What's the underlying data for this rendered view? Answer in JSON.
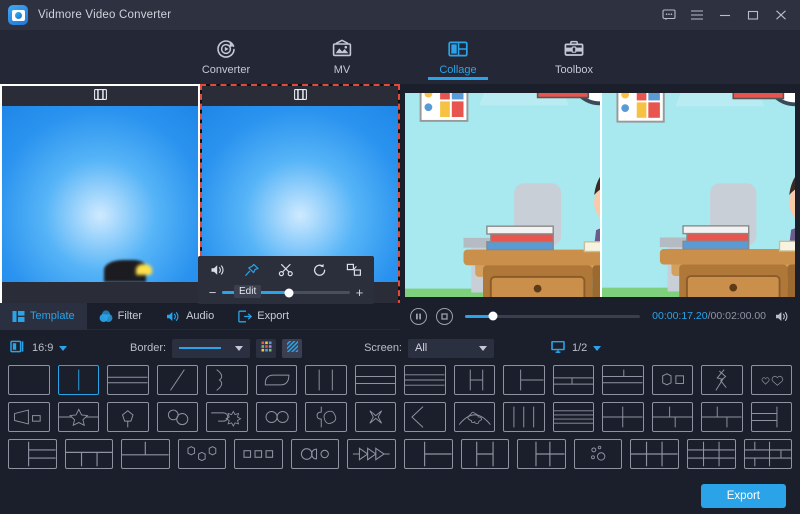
{
  "window": {
    "app_title": "Vidmore Video Converter",
    "controls": [
      {
        "name": "feedback-icon",
        "label": "Feedback"
      },
      {
        "name": "menu-icon",
        "label": "Menu"
      },
      {
        "name": "minimize-icon",
        "label": "Minimize"
      },
      {
        "name": "maximize-icon",
        "label": "Maximize"
      },
      {
        "name": "close-icon",
        "label": "Close"
      }
    ]
  },
  "nav": {
    "tabs": [
      {
        "label": "Converter",
        "icon": "converter-icon",
        "active": false
      },
      {
        "label": "MV",
        "icon": "mv-icon",
        "active": false
      },
      {
        "label": "Collage",
        "icon": "collage-icon",
        "active": true
      },
      {
        "label": "Toolbox",
        "icon": "toolbox-icon",
        "active": false
      }
    ]
  },
  "editor": {
    "cells": [
      {
        "name": "collage-cell-1",
        "icon": "film-strip-icon",
        "selected": false
      },
      {
        "name": "collage-cell-2",
        "icon": "film-strip-icon",
        "selected": true
      }
    ],
    "edit_toolbar": {
      "tooltip": "Edit",
      "tools": [
        {
          "name": "volume-icon",
          "label": "Volume"
        },
        {
          "name": "pin-icon",
          "label": "Pin"
        },
        {
          "name": "trim-scissors-icon",
          "label": "Trim"
        },
        {
          "name": "rotate-icon",
          "label": "Rotate"
        },
        {
          "name": "crop-icon",
          "label": "Crop"
        }
      ],
      "minus": "−",
      "plus": "+",
      "value_percent": 52
    }
  },
  "player": {
    "pause_icon": "pause-icon",
    "stop_icon": "stop-icon",
    "volume_icon": "speaker-icon",
    "current_time": "00:00:17.20",
    "separator": "/",
    "total_time": "00:02:00.00",
    "progress_percent": 16
  },
  "section_tabs": [
    {
      "label": "Template",
      "icon": "template-icon",
      "active": true
    },
    {
      "label": "Filter",
      "icon": "filter-icon",
      "active": false
    },
    {
      "label": "Audio",
      "icon": "audio-icon",
      "active": false
    },
    {
      "label": "Export",
      "icon": "export-icon",
      "active": false
    }
  ],
  "options": {
    "aspect_icon": "aspect-ratio-icon",
    "aspect_value": "16:9",
    "border_label": "Border:",
    "border_style": "solid-line",
    "border_color_icon": "color-palette-icon",
    "border_pattern_icon": "stripe-pattern-icon",
    "screen_label": "Screen:",
    "screen_value": "All",
    "monitor_icon": "monitor-icon",
    "page_value": "1/2"
  },
  "templates": {
    "rows": [
      [
        {
          "name": "tpl-single",
          "active": false
        },
        {
          "name": "tpl-two-vertical",
          "active": true
        },
        {
          "name": "tpl-two-horizontal",
          "active": false
        },
        {
          "name": "tpl-diagonal-split",
          "active": false
        },
        {
          "name": "tpl-curved-split",
          "active": false
        },
        {
          "name": "tpl-rounded-inset",
          "active": false
        },
        {
          "name": "tpl-three-columns",
          "active": false
        },
        {
          "name": "tpl-three-rows",
          "active": false
        },
        {
          "name": "tpl-four-rows",
          "active": false
        },
        {
          "name": "tpl-left-large-two-right",
          "active": false
        },
        {
          "name": "tpl-two-left-two-right",
          "active": false
        },
        {
          "name": "tpl-top-bar-two-bottom",
          "active": false
        },
        {
          "name": "tpl-top-split-bottom-bar",
          "active": false
        },
        {
          "name": "tpl-hexagon-square",
          "active": false
        },
        {
          "name": "tpl-lightning-split",
          "active": false
        },
        {
          "name": "tpl-two-hearts",
          "active": false
        }
      ],
      [
        {
          "name": "tpl-megaphone",
          "active": false
        },
        {
          "name": "tpl-star-band",
          "active": false
        },
        {
          "name": "tpl-pentagon",
          "active": false
        },
        {
          "name": "tpl-two-circles-overlap",
          "active": false
        },
        {
          "name": "tpl-tag-sunburst",
          "active": false
        },
        {
          "name": "tpl-two-ovals",
          "active": false
        },
        {
          "name": "tpl-puzzle-split",
          "active": false
        },
        {
          "name": "tpl-cross-burst",
          "active": false
        },
        {
          "name": "tpl-arrow-left",
          "active": false
        },
        {
          "name": "tpl-arch-flower",
          "active": false
        },
        {
          "name": "tpl-four-columns",
          "active": false
        },
        {
          "name": "tpl-five-rows",
          "active": false
        },
        {
          "name": "tpl-two-by-two",
          "active": false
        },
        {
          "name": "tpl-mixed-left-two-right",
          "active": false
        },
        {
          "name": "tpl-mixed-top-bottom",
          "active": false
        },
        {
          "name": "tpl-two-rows-left-big-right",
          "active": false
        }
      ],
      [
        {
          "name": "tpl-left-big-three-right",
          "active": false
        },
        {
          "name": "tpl-top-bar-three-bottom",
          "active": false
        },
        {
          "name": "tpl-two-top-one-bottom",
          "active": false
        },
        {
          "name": "tpl-three-hexagons",
          "active": false
        },
        {
          "name": "tpl-three-squares",
          "active": false
        },
        {
          "name": "tpl-circle-pac-circle",
          "active": false
        },
        {
          "name": "tpl-triple-arrow",
          "active": false
        },
        {
          "name": "tpl-left-two-right-split",
          "active": false
        },
        {
          "name": "tpl-four-grid-left-big",
          "active": false
        },
        {
          "name": "tpl-left-big-four-right",
          "active": false
        },
        {
          "name": "tpl-bubbles",
          "active": false
        },
        {
          "name": "tpl-six-grid",
          "active": false
        },
        {
          "name": "tpl-nine-grid",
          "active": false
        },
        {
          "name": "tpl-collage-mixed",
          "active": false
        }
      ]
    ]
  },
  "footer": {
    "export_label": "Export"
  }
}
